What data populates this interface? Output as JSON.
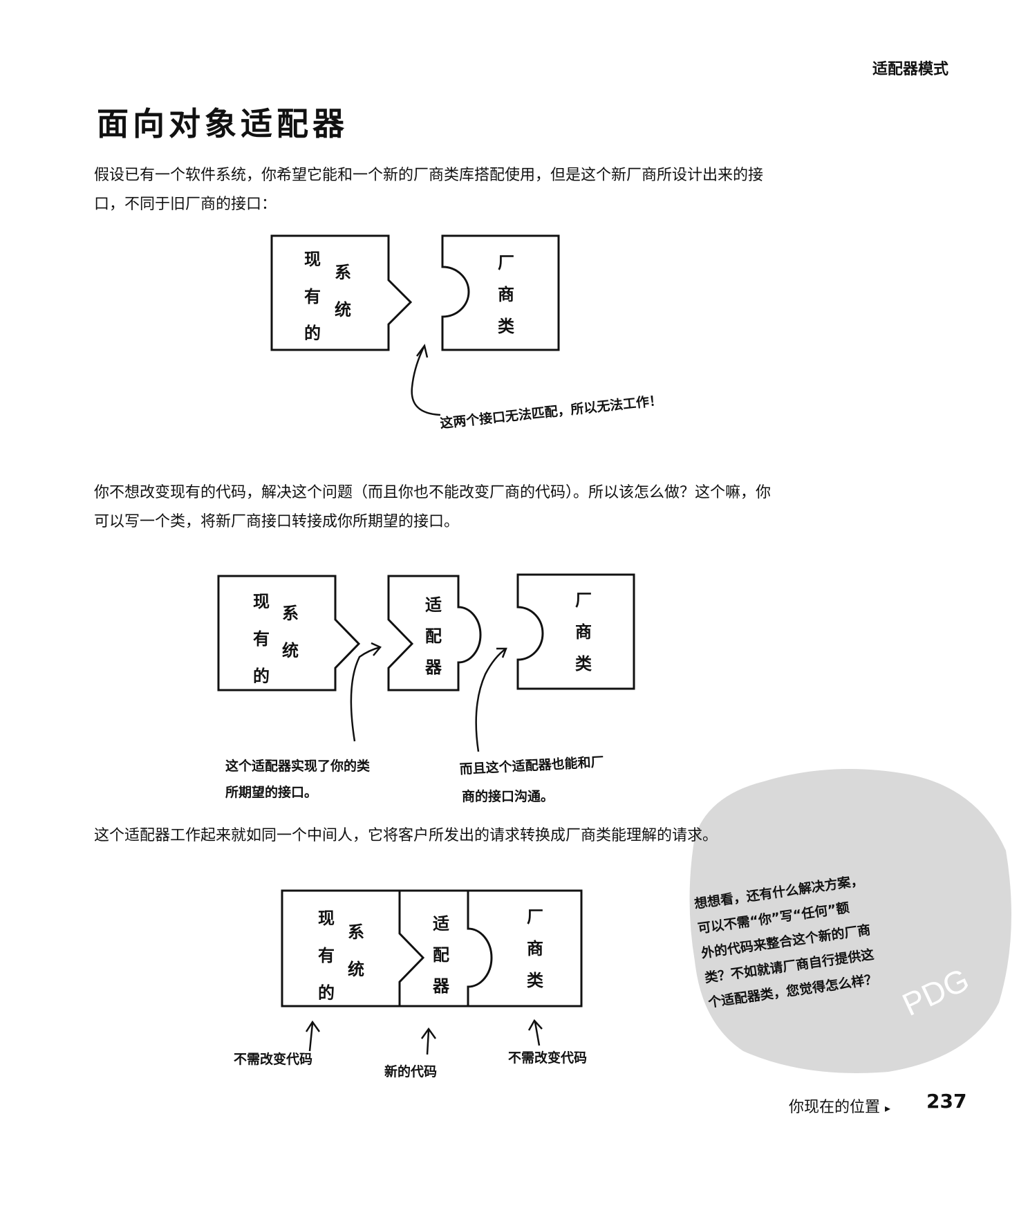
{
  "header": {
    "section": "适配器模式"
  },
  "title": "面向对象适配器",
  "paragraphs": [
    "假设已有一个软件系统，你希望它能和一个新的厂商类库搭配使用，但是这个新厂商所设计出来的接口，不同于旧厂商的接口：",
    "你不想改变现有的代码，解决这个问题（而且你也不能改变厂商的代码）。所以该怎么做？这个嘛，你可以写一个类，将新厂商接口转接成你所期望的接口。",
    "这个适配器工作起来就如同一个中间人，它将客户所发出的请求转换成厂商类能理解的请求。"
  ],
  "figure1": {
    "existing_chars": [
      "现",
      "有",
      "的",
      "系",
      "统"
    ],
    "vendor_chars": [
      "厂",
      "商",
      "类"
    ],
    "note": "这两个接口无法匹配，所以无法工作！"
  },
  "figure2": {
    "existing_chars": [
      "现",
      "有",
      "的",
      "系",
      "统"
    ],
    "adapter_chars": [
      "适",
      "配",
      "器"
    ],
    "vendor_chars": [
      "厂",
      "商",
      "类"
    ],
    "note_left": [
      "这个适配器实现了你的类",
      "所期望的接口。"
    ],
    "note_right": [
      "而且这个适配器也能和厂",
      "商的接口沟通。"
    ]
  },
  "figure3": {
    "existing_chars": [
      "现",
      "有",
      "的",
      "系",
      "统"
    ],
    "adapter_chars": [
      "适",
      "配",
      "器"
    ],
    "vendor_chars": [
      "厂",
      "商",
      "类"
    ],
    "label_left": "不需改变代码",
    "label_mid": "新的代码",
    "label_right": "不需改变代码"
  },
  "side_note": [
    "想想看，还有什么解决方案，",
    "可以不需“你”写“任何”额",
    "外的代码来整合这个新的厂商",
    "类？不如就请厂商自行提供这",
    "个适配器类，您觉得怎么样？"
  ],
  "watermark": {
    "text": "PDG"
  },
  "footer": {
    "nav_label": "你现在的位置",
    "arrow_glyph": "▸",
    "page_number": "237"
  }
}
